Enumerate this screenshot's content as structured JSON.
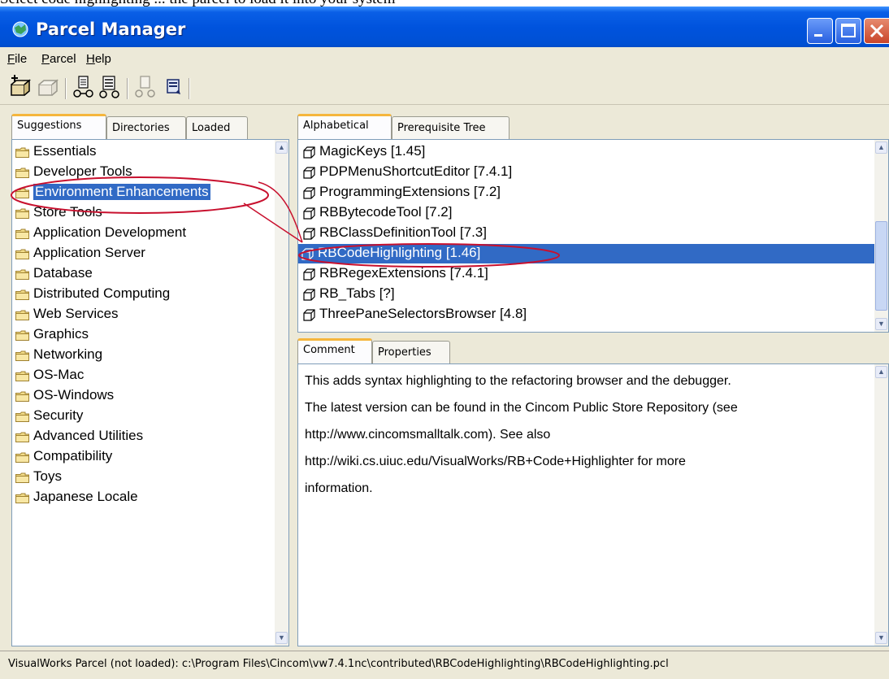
{
  "caption": "Select code highlighting ... the parcel to load it into your system",
  "window": {
    "title": "Parcel Manager"
  },
  "menu": {
    "file": "File",
    "parcel": "Parcel",
    "help": "Help"
  },
  "toolbar": [
    "load-parcel-icon",
    "unload-parcel-icon",
    "parcel-properties-icon",
    "parcel-tree-icon",
    "publish-parcel-icon",
    "save-parcel-icon"
  ],
  "left_tabs": [
    "Suggestions",
    "Directories",
    "Loaded"
  ],
  "categories": [
    "Essentials",
    "Developer Tools",
    "Environment Enhancements",
    "Store Tools",
    "Application Development",
    "Application Server",
    "Database",
    "Distributed Computing",
    "Web Services",
    "Graphics",
    "Networking",
    "OS-Mac",
    "OS-Windows",
    "Security",
    "Advanced Utilities",
    "Compatibility",
    "Toys",
    "Japanese Locale"
  ],
  "selected_category": "Environment Enhancements",
  "right_tabs": [
    "Alphabetical",
    "Prerequisite Tree"
  ],
  "parcels": [
    "MagicKeys [1.45]",
    "PDPMenuShortcutEditor [7.4.1]",
    "ProgrammingExtensions [7.2]",
    "RBBytecodeTool [7.2]",
    "RBClassDefinitionTool [7.3]",
    "RBCodeHighlighting [1.46]",
    "RBRegexExtensions [7.4.1]",
    "RB_Tabs [?]",
    "ThreePaneSelectorsBrowser [4.8]"
  ],
  "selected_parcel": "RBCodeHighlighting [1.46]",
  "detail_tabs": [
    "Comment",
    "Properties"
  ],
  "comment": [
    "This adds syntax highlighting to the refactoring browser and the debugger.",
    "The latest version can be found in the Cincom Public Store Repository (see",
    "http://www.cincomsmalltalk.com). See also",
    "http://wiki.cs.uiuc.edu/VisualWorks/RB+Code+Highlighter for more",
    "information."
  ],
  "status": "VisualWorks Parcel (not loaded): c:\\Program Files\\Cincom\\vw7.4.1nc\\contributed\\RBCodeHighlighting\\RBCodeHighlighting.pcl",
  "colors": {
    "title_bar": "#0053dd",
    "selection": "#316ac5",
    "annotation": "#c8102e",
    "tab_accent": "#f5b63d"
  }
}
